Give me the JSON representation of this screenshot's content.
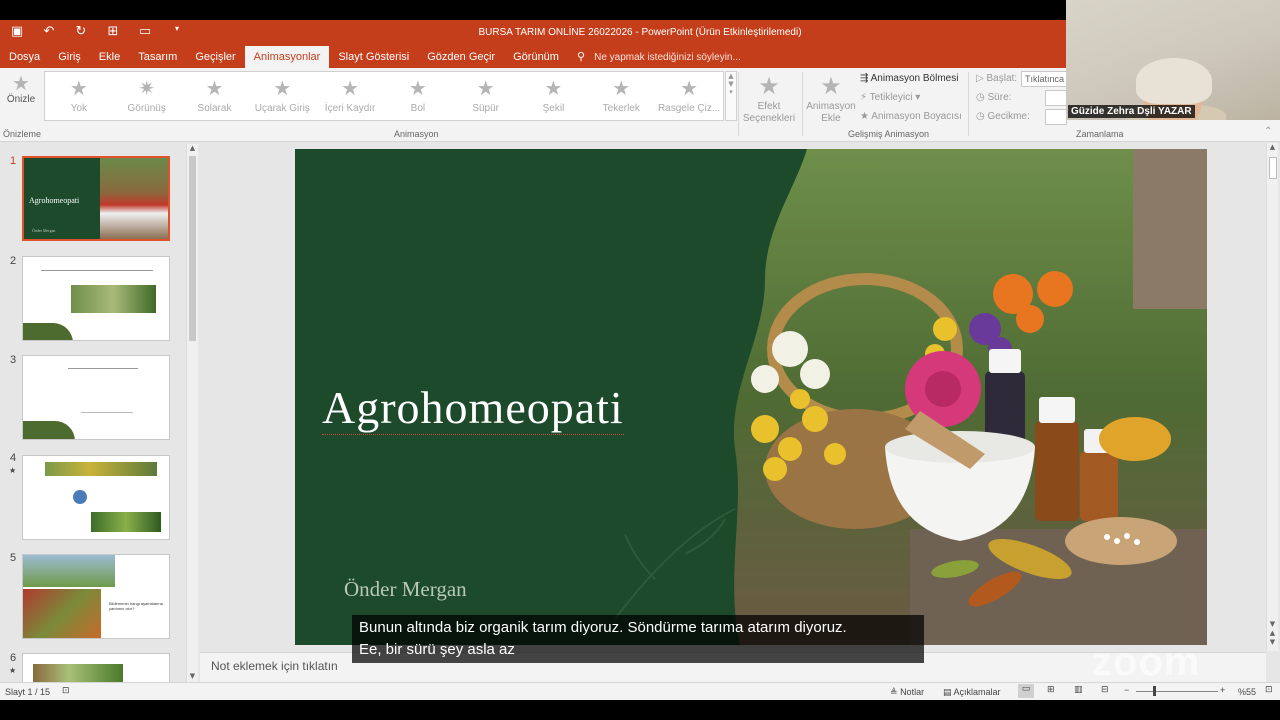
{
  "window": {
    "title": "BURSA TARIM ONLİNE 26022026 - PowerPoint (Ürün Etkinleştirilemedi)"
  },
  "tabs": [
    {
      "label": "Dosya"
    },
    {
      "label": "Giriş"
    },
    {
      "label": "Ekle"
    },
    {
      "label": "Tasarım"
    },
    {
      "label": "Geçişler"
    },
    {
      "label": "Animasyonlar",
      "active": true
    },
    {
      "label": "Slayt Gösterisi"
    },
    {
      "label": "Gözden Geçir"
    },
    {
      "label": "Görünüm"
    }
  ],
  "tell_me": "Ne yapmak istediğinizi söyleyin...",
  "ribbon": {
    "preview_label": "Önizle",
    "preview_group": "Önizleme",
    "animation_group": "Animasyon",
    "animations": [
      "Yok",
      "Görünüş",
      "Solarak",
      "Uçarak Giriş",
      "İçeri Kaydır",
      "Bol",
      "Süpür",
      "Şekil",
      "Tekerlek",
      "Rasgele Çiz..."
    ],
    "effect_options": [
      "Efekt",
      "Seçenekleri"
    ],
    "add_animation": [
      "Animasyon",
      "Ekle"
    ],
    "animation_pane": "Animasyon Bölmesi",
    "trigger": "Tetikleyici",
    "animation_painter": "Animasyon Boyacısı",
    "advanced_group": "Gelişmiş Animasyon",
    "start_label": "Başlat:",
    "start_value": "Tıklatınca",
    "duration_label": "Süre:",
    "delay_label": "Gecikme:",
    "timing_group": "Zamanlama"
  },
  "camera": {
    "participant_name": "Güzide Zehra Dşli YAZAR"
  },
  "thumbnails": [
    {
      "num": "1",
      "selected": true,
      "title": "Agrohomeopati",
      "author": "Önder Mergan",
      "animated": false
    },
    {
      "num": "2",
      "animated": false
    },
    {
      "num": "3",
      "animated": false
    },
    {
      "num": "4",
      "animated": true
    },
    {
      "num": "5",
      "animated": false,
      "text": "Bildirmenin hangi aşamalarına yardımcı olur?"
    },
    {
      "num": "6",
      "animated": true
    }
  ],
  "slide": {
    "title": "Agrohomeopati",
    "author": "Önder Mergan"
  },
  "notes_placeholder": "Not eklemek için tıklatın",
  "subtitles": {
    "line1": "Bunun altında biz organik tarım diyoruz. Söndürme tarıma atarım diyoruz.",
    "line2": "Ee, bir sürü şey asla az"
  },
  "watermark": "zoom",
  "status": {
    "slide_info": "Slayt 1 / 15",
    "notes_label": "Notlar",
    "comments_label": "Açıklamalar",
    "zoom_level": "%55"
  },
  "colors": {
    "accent": "#c43e1c",
    "slide_bg": "#1c4a2b"
  }
}
